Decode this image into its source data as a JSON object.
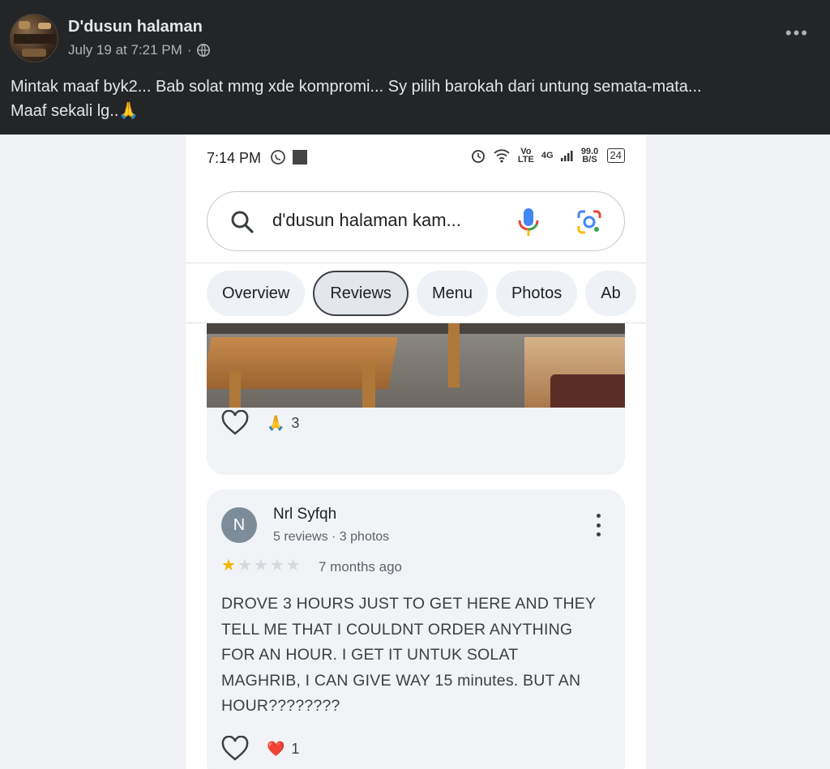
{
  "post": {
    "author": "D'dusun halaman",
    "timestamp": "July 19 at 7:21 PM",
    "visibility_separator": "·",
    "privacy_icon": "globe-icon",
    "more_label": "•••",
    "text_line1": "Mintak maaf byk2... Bab solat mmg xde kompromi... Sy pilih barokah dari untung semata-mata...",
    "text_line2": "Maaf sekali lg..🙏"
  },
  "phone": {
    "status_bar": {
      "time": "7:14 PM",
      "net_label": "Vo LTE",
      "signal_label": "4G",
      "speed_label": "99.0 B/S",
      "battery": "24"
    },
    "search": {
      "query": "d'dusun halaman kam...",
      "icons": [
        "search-icon",
        "mic-icon",
        "lens-icon"
      ]
    },
    "tabs": [
      {
        "label": "Overview",
        "active": false
      },
      {
        "label": "Reviews",
        "active": true
      },
      {
        "label": "Menu",
        "active": false
      },
      {
        "label": "Photos",
        "active": false
      },
      {
        "label": "Ab",
        "active": false
      }
    ],
    "review1": {
      "reaction_emoji": "🙏",
      "reaction_count": "3"
    },
    "review2": {
      "avatar_letter": "N",
      "name": "Nrl Syfqh",
      "meta": "5 reviews · 3 photos",
      "rating": 1,
      "rating_max": 5,
      "time": "7 months ago",
      "body_lines": [
        "DROVE 3 HOURS JUST TO GET HERE AND THEY",
        "TELL ME THAT I COULDNT ORDER ANYTHING",
        "FOR AN HOUR. I GET IT UNTUK SOLAT",
        "MAGHRIB, I CAN GIVE WAY 15 minutes. BUT AN",
        "HOUR????????"
      ],
      "reaction_emoji": "❤️",
      "reaction_count": "1"
    }
  },
  "colors": {
    "fb_dark": "#242526",
    "page_bg": "#f0f2f5",
    "star": "#f4b400",
    "google_blue": "#4285f4",
    "google_red": "#ea4335",
    "google_yellow": "#fbbc05",
    "google_green": "#34a853"
  }
}
